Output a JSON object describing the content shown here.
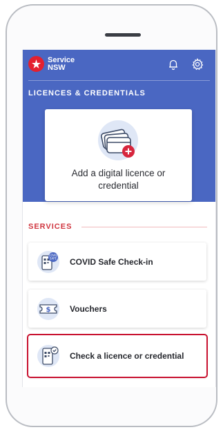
{
  "app": {
    "brand_line1": "Service",
    "brand_line2": "NSW"
  },
  "licences": {
    "section_title": "LICENCES & CREDENTIALS",
    "add_card_label": "Add a digital licence or credential"
  },
  "services": {
    "section_title": "SERVICES",
    "items": [
      {
        "label": "COVID Safe Check-in",
        "icon": "covid-safe-qr-icon"
      },
      {
        "label": "Vouchers",
        "icon": "voucher-ticket-icon"
      },
      {
        "label": "Check a licence or credential",
        "icon": "phone-check-icon",
        "highlighted": true
      }
    ]
  },
  "icons": {
    "notifications": "bell-icon",
    "settings": "gear-icon"
  },
  "colors": {
    "header_blue": "#4a67c2",
    "brand_red": "#e4202f",
    "highlight_red": "#c8102e",
    "section_red": "#d0353f"
  }
}
